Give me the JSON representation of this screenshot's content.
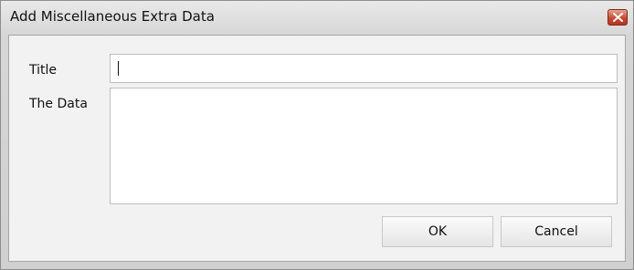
{
  "window": {
    "title": "Add Miscellaneous Extra Data",
    "close_icon": "close-icon"
  },
  "form": {
    "title_label": "Title",
    "title_value": "",
    "data_label": "The Data",
    "data_value": ""
  },
  "buttons": {
    "ok_label": "OK",
    "cancel_label": "Cancel"
  },
  "colors": {
    "close_button": "#c94a2f",
    "window_bg": "#d7d7d7",
    "client_bg": "#f2f2f2"
  }
}
